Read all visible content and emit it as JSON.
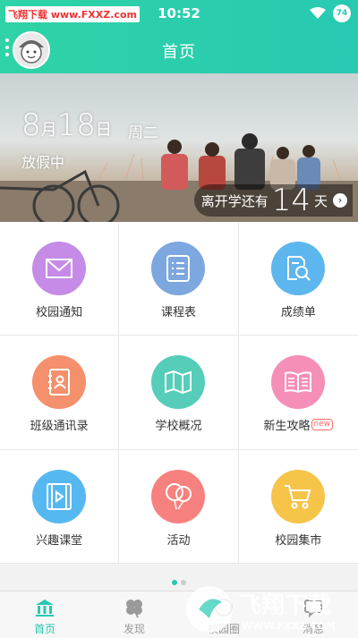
{
  "status_bar": {
    "watermark": "飞翔下载 www.FXXZ.com",
    "time": "10:52",
    "battery": "74"
  },
  "app_bar": {
    "title": "首页"
  },
  "banner": {
    "month": "8",
    "month_unit": "月",
    "day": "18",
    "day_unit": "日",
    "weekday": "周二",
    "status": "放假中",
    "countdown_label": "离开学还有",
    "countdown_days": "14",
    "countdown_unit": "天"
  },
  "grid": [
    {
      "label": "校园通知",
      "color": "#c58be6",
      "icon": "mail-icon"
    },
    {
      "label": "课程表",
      "color": "#7ca7df",
      "icon": "list-icon"
    },
    {
      "label": "成绩单",
      "color": "#5db6ee",
      "icon": "report-search-icon"
    },
    {
      "label": "班级通讯录",
      "color": "#f4906b",
      "icon": "contacts-book-icon"
    },
    {
      "label": "学校概况",
      "color": "#55cdb9",
      "icon": "map-icon"
    },
    {
      "label": "新生攻略",
      "color": "#f58fb8",
      "icon": "open-book-icon",
      "badge": "new"
    },
    {
      "label": "兴趣课堂",
      "color": "#56b8f0",
      "icon": "video-icon"
    },
    {
      "label": "活动",
      "color": "#f7817e",
      "icon": "balloons-icon"
    },
    {
      "label": "校园集市",
      "color": "#f7c44a",
      "icon": "shopping-cart-icon"
    }
  ],
  "bottom_nav": [
    {
      "label": "首页",
      "icon": "home-building-icon",
      "active": true
    },
    {
      "label": "发现",
      "icon": "clover-icon",
      "active": false
    },
    {
      "label": "校园圈",
      "icon": "circle-icon",
      "active": false
    },
    {
      "label": "消息",
      "icon": "message-icon",
      "active": false
    }
  ],
  "colors": {
    "primary": "#27c9b2",
    "accent_start": "#2fd3a6"
  },
  "watermark_bottom": {
    "brand": "飞翔下载",
    "url": "WWW.FXXZ.COM"
  }
}
